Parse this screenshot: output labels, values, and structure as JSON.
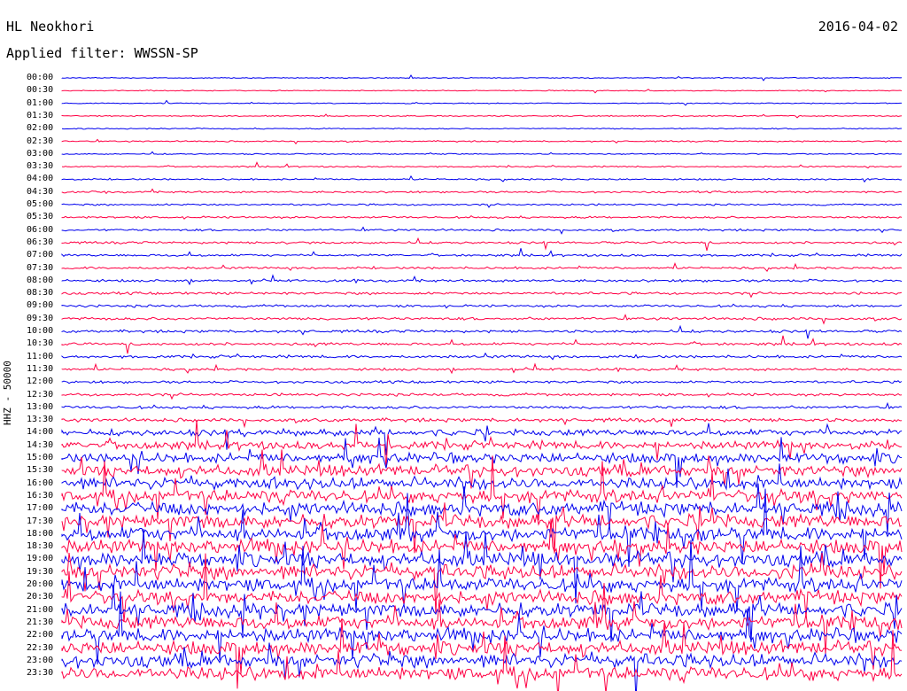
{
  "header": {
    "station": "HL Neokhori",
    "date": "2016-04-02",
    "filter": "Applied filter: WWSSN-SP"
  },
  "chart_data": {
    "type": "line",
    "title": "HL Neokhori",
    "ylabel": "HHZ - 50000",
    "row_labels": [
      "00:00",
      "00:30",
      "01:00",
      "01:30",
      "02:00",
      "02:30",
      "03:00",
      "03:30",
      "04:00",
      "04:30",
      "05:00",
      "05:30",
      "06:00",
      "06:30",
      "07:00",
      "07:30",
      "08:00",
      "08:30",
      "09:00",
      "09:30",
      "10:00",
      "10:30",
      "11:00",
      "11:30",
      "12:00",
      "12:30",
      "13:00",
      "13:30",
      "14:00",
      "14:30",
      "15:00",
      "15:30",
      "16:00",
      "16:30",
      "17:00",
      "17:30",
      "18:00",
      "18:30",
      "19:00",
      "19:30",
      "20:00",
      "20:30",
      "21:00",
      "21:30",
      "22:00",
      "22:30",
      "23:00",
      "23:30"
    ],
    "tick_labels": [
      "00:00",
      "00:30",
      "01:00",
      "01:30",
      "02:00",
      "02:30",
      "03:00",
      "03:30",
      "04:00",
      "04:30",
      "05:00",
      "05:30",
      "06:00",
      "06:30",
      "07:00",
      "07:30",
      "08:00",
      "08:30",
      "09:00",
      "09:30",
      "10:00",
      "10:30",
      "11:00",
      "11:30",
      "12:00",
      "12:30",
      "13:00",
      "13:30",
      "14:00",
      "15:00",
      "15:30",
      "16:00",
      "16:30",
      "17:00",
      "17:30",
      "18:00",
      "18:30",
      "19:00",
      "19:30",
      "20:00",
      "20:30",
      "21:00",
      "21:30",
      "22:00",
      "22:30",
      "23:00",
      "23:30"
    ],
    "series_colors": [
      "#0000ee",
      "#ff0044"
    ],
    "noise_level": [
      0.2,
      0.2,
      0.2,
      0.25,
      0.25,
      0.3,
      0.25,
      0.3,
      0.35,
      0.4,
      0.4,
      0.45,
      0.45,
      0.5,
      0.5,
      0.5,
      0.55,
      0.55,
      0.55,
      0.6,
      0.6,
      0.6,
      0.6,
      0.55,
      0.55,
      0.6,
      0.65,
      0.8,
      1.4,
      1.8,
      2.2,
      2.5,
      2.6,
      2.8,
      3.0,
      3.0,
      3.1,
      3.1,
      3.2,
      3.2,
      3.1,
      3.0,
      3.0,
      3.0,
      3.0,
      3.0,
      3.0,
      3.0
    ]
  }
}
